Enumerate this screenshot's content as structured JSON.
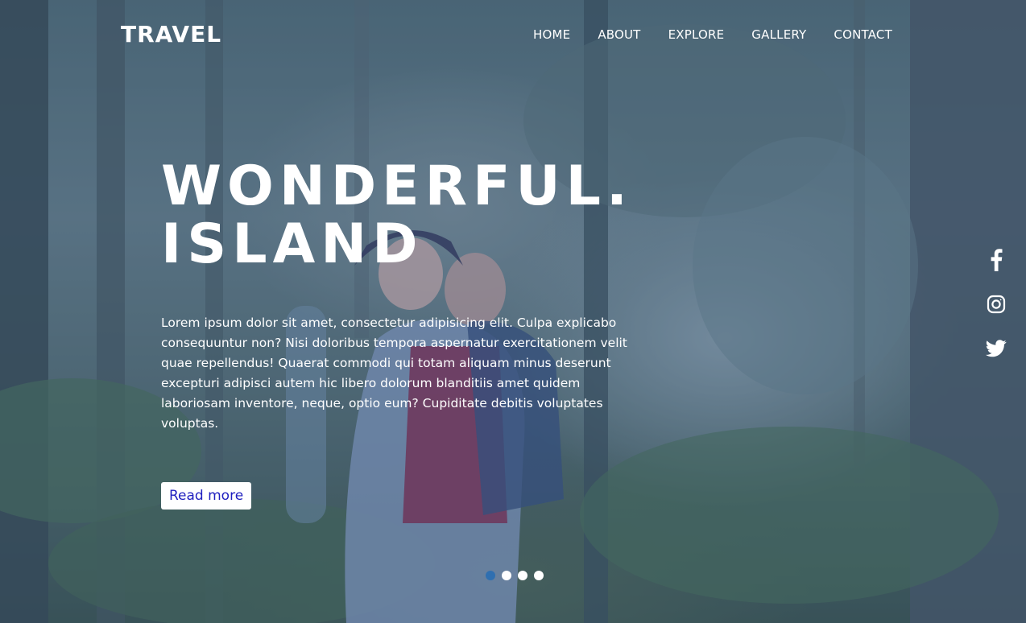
{
  "header": {
    "logo": "TRAVEL",
    "nav": [
      "HOME",
      "ABOUT",
      "EXPLORE",
      "GALLERY",
      "CONTACT"
    ]
  },
  "hero": {
    "title_line1": "WONDERFUL.",
    "title_line2": "ISLAND",
    "description": "Lorem ipsum dolor sit amet, consectetur adipisicing elit. Culpa explicabo consequuntur non? Nisi doloribus tempora aspernatur exercitationem velit quae repellendus! Quaerat commodi qui totam aliquam minus deserunt excepturi adipisci autem hic libero dolorum blanditiis amet quidem laboriosam inventore, neque, optio eum? Cupiditate debitis voluptates voluptas.",
    "button_label": "Read more"
  },
  "social": [
    "facebook-icon",
    "instagram-icon",
    "twitter-icon"
  ],
  "slider": {
    "slide_count": 4,
    "active_index": 0
  },
  "colors": {
    "tint": "#28408c",
    "button_text": "#1f1fbf",
    "active_dot": "#2f6fb0",
    "text": "#ffffff"
  }
}
